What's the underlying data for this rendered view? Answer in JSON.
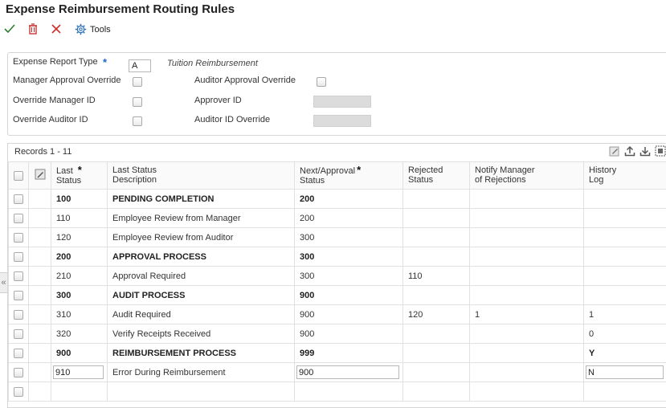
{
  "title": "Expense Reimbursement Routing Rules",
  "toolbar": {
    "tools_label": "Tools"
  },
  "header": {
    "expense_report_type_label": "Expense Report Type",
    "expense_report_type_value": "A",
    "expense_report_type_desc": "Tuition Reimbursement",
    "manager_approval_override_label": "Manager Approval Override",
    "auditor_approval_override_label": "Auditor Approval Override",
    "override_manager_id_label": "Override Manager ID",
    "approver_id_label": "Approver ID",
    "override_auditor_id_label": "Override Auditor ID",
    "auditor_id_override_label": "Auditor ID Override"
  },
  "grid": {
    "records_label": "Records 1 - 11",
    "columns": {
      "last_status": [
        "Last",
        "Status"
      ],
      "last_status_desc": [
        "Last Status",
        "Description"
      ],
      "next_status": [
        "Next/Approval",
        "Status"
      ],
      "rejected_status": [
        "Rejected",
        "Status"
      ],
      "notify_manager": [
        "Notify Manager",
        "of Rejections"
      ],
      "history_log": [
        "History",
        "Log"
      ]
    },
    "rows": [
      {
        "last": "100",
        "desc": "PENDING COMPLETION",
        "next": "200",
        "rejected": "",
        "notify": "",
        "history": ""
      },
      {
        "last": "110",
        "desc": "Employee Review from Manager",
        "next": "200",
        "rejected": "",
        "notify": "",
        "history": ""
      },
      {
        "last": "120",
        "desc": "Employee Review from Auditor",
        "next": "300",
        "rejected": "",
        "notify": "",
        "history": ""
      },
      {
        "last": "200",
        "desc": "APPROVAL PROCESS",
        "next": "300",
        "rejected": "",
        "notify": "",
        "history": ""
      },
      {
        "last": "210",
        "desc": "Approval Required",
        "next": "300",
        "rejected": "110",
        "notify": "",
        "history": ""
      },
      {
        "last": "300",
        "desc": "AUDIT PROCESS",
        "next": "900",
        "rejected": "",
        "notify": "",
        "history": ""
      },
      {
        "last": "310",
        "desc": "Audit Required",
        "next": "900",
        "rejected": "120",
        "notify": "1",
        "history": "1"
      },
      {
        "last": "320",
        "desc": "Verify Receipts Received",
        "next": "900",
        "rejected": "",
        "notify": "",
        "history": "0"
      },
      {
        "last": "900",
        "desc": "REIMBURSEMENT PROCESS",
        "next": "999",
        "rejected": "",
        "notify": "",
        "history": "Y"
      },
      {
        "last": "910",
        "desc": "Error During Reimbursement",
        "next": "900",
        "rejected": "",
        "notify": "",
        "history": "N"
      }
    ]
  },
  "colors": {
    "required_star": "#1b6ac9",
    "toolbar_check": "#2e7d32",
    "toolbar_delete": "#c62828"
  }
}
